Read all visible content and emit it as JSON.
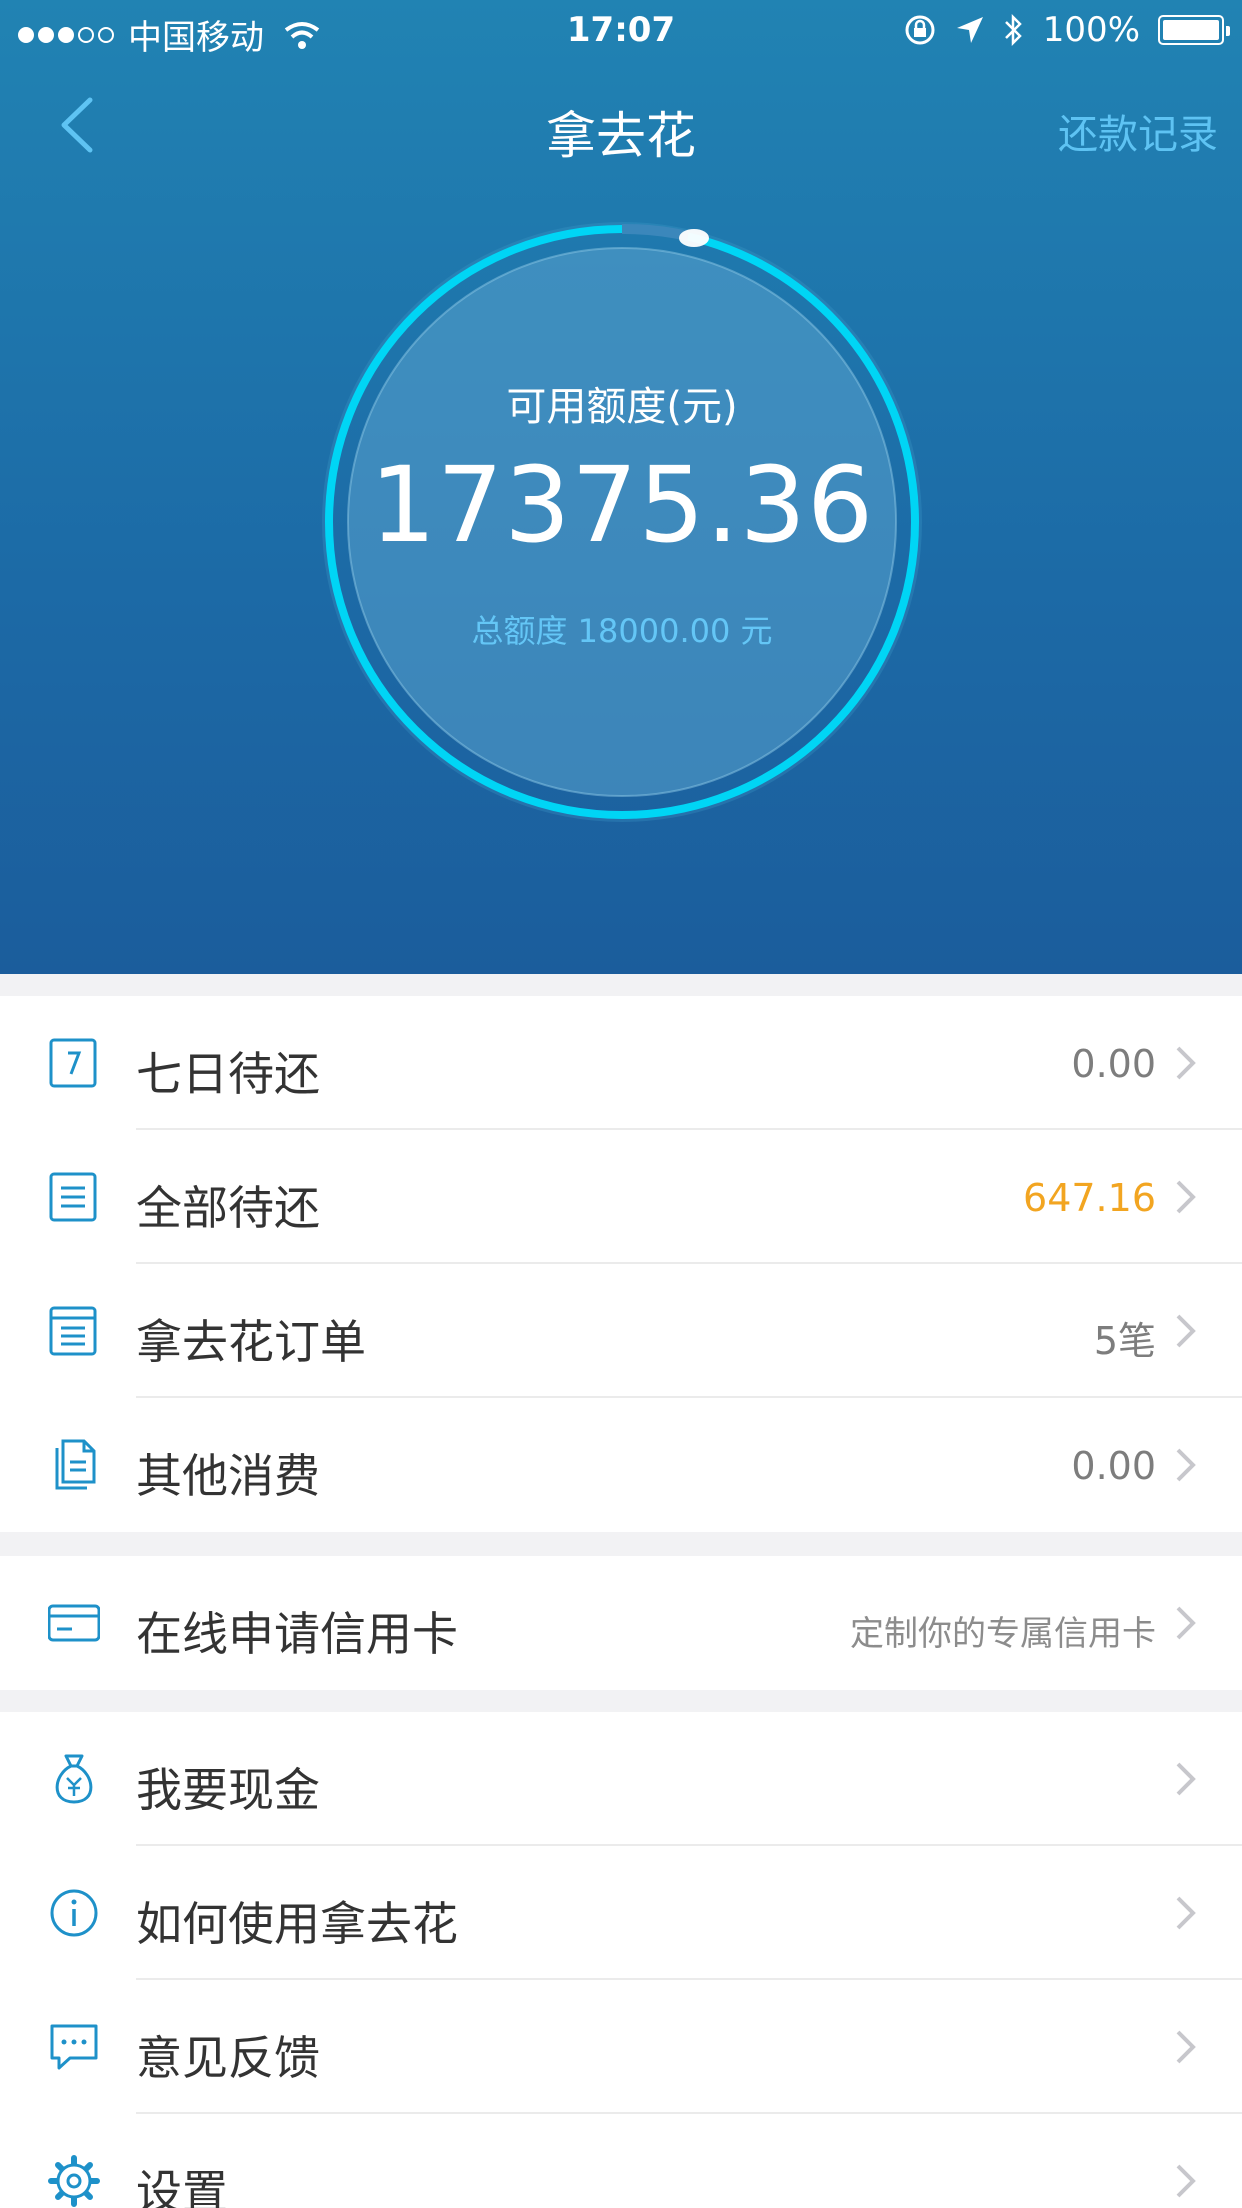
{
  "status_bar": {
    "carrier": "中国移动",
    "time": "17:07",
    "battery": "100%"
  },
  "nav": {
    "title": "拿去花",
    "right_action": "还款记录"
  },
  "credit": {
    "label": "可用额度(元)",
    "available": "17375.36",
    "total": "总额度 18000.00 元",
    "used_fraction": 0.0347
  },
  "colors": {
    "header_top": "#2183b3",
    "header_bottom": "#1b5d9c",
    "ring": "#00d5f5",
    "link": "#5ec3f3",
    "orange": "#f2a521",
    "icon": "#1e91c9"
  },
  "group1": [
    {
      "icon": "calendar-7-icon",
      "label": "七日待还",
      "value": "0.00",
      "style": ""
    },
    {
      "icon": "document-icon",
      "label": "全部待还",
      "value": "647.16",
      "style": "orange"
    },
    {
      "icon": "list-icon",
      "label": "拿去花订单",
      "value": "5笔",
      "style": ""
    },
    {
      "icon": "documents-icon",
      "label": "其他消费",
      "value": "0.00",
      "style": ""
    }
  ],
  "group2": [
    {
      "icon": "credit-card-icon",
      "label": "在线申请信用卡",
      "value": "定制你的专属信用卡",
      "style": "small"
    }
  ],
  "group3": [
    {
      "icon": "money-bag-icon",
      "label": "我要现金",
      "value": ""
    },
    {
      "icon": "info-icon",
      "label": "如何使用拿去花",
      "value": ""
    },
    {
      "icon": "feedback-icon",
      "label": "意见反馈",
      "value": ""
    },
    {
      "icon": "gear-icon",
      "label": "设置",
      "value": ""
    }
  ]
}
